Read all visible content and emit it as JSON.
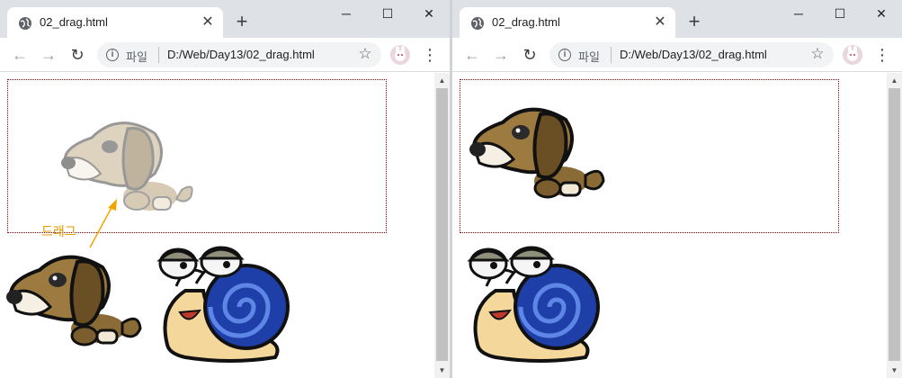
{
  "browser": {
    "tab_title": "02_drag.html",
    "tab_close": "✕",
    "new_tab": "+",
    "window_min": "─",
    "window_max": "☐",
    "window_close": "✕",
    "nav_back": "←",
    "nav_forward": "→",
    "nav_reload": "↻",
    "url_prefix": "파일",
    "url": "D:/Web/Day13/02_drag.html",
    "star": "☆",
    "menu": "⋮"
  },
  "annotation": {
    "drag_label": "드래그"
  },
  "colors": {
    "drop_border": "#8b0000",
    "annotation": "#e59a00"
  }
}
